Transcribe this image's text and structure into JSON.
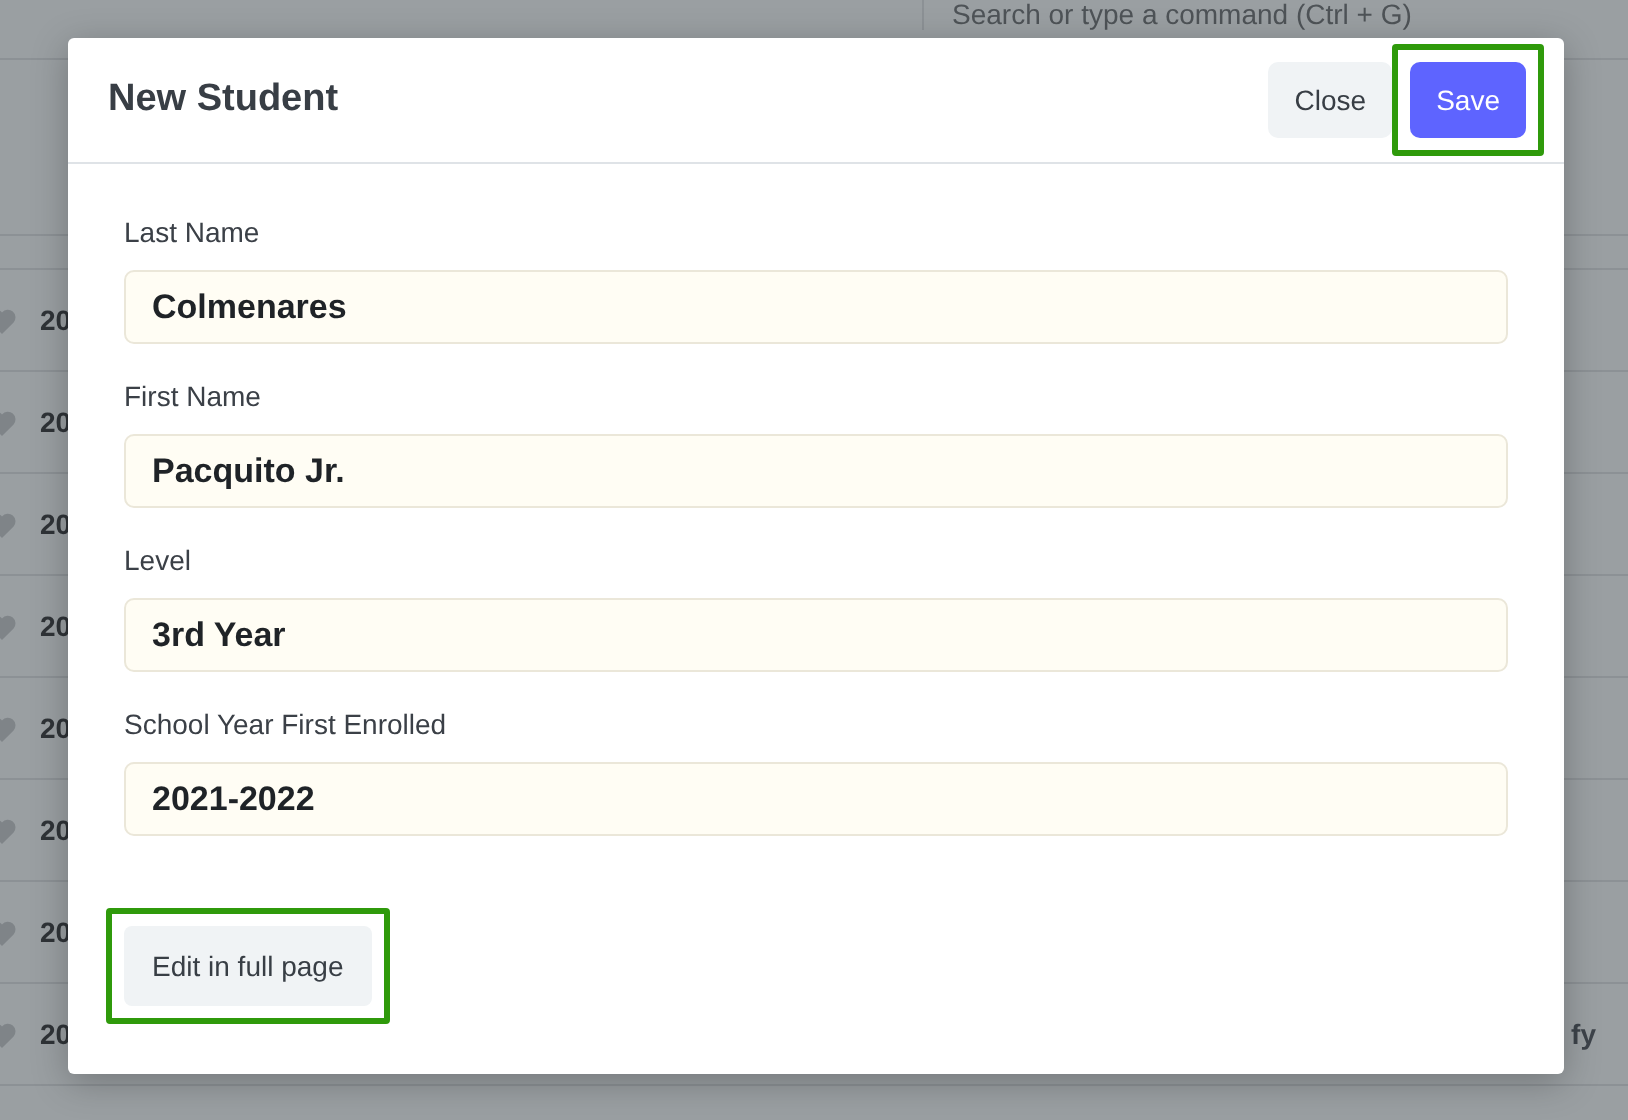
{
  "background": {
    "search": {
      "placeholder": "Search or type a command (Ctrl + G)"
    },
    "rows": [
      {
        "column_1": "20"
      },
      {
        "column_1": "20"
      },
      {
        "column_1": "20"
      },
      {
        "column_1": "20"
      },
      {
        "column_1": "20"
      },
      {
        "column_1": "20"
      },
      {
        "column_1": "20"
      },
      {
        "column_1": "20",
        "column_3": "fy"
      }
    ]
  },
  "modal": {
    "title": "New Student",
    "buttons": [
      {
        "label": "Close",
        "kind": "secondary",
        "highlighted": false
      },
      {
        "label": "Save",
        "kind": "primary",
        "highlighted": true
      }
    ],
    "fields": [
      {
        "label": "Last Name",
        "value": "Colmenares"
      },
      {
        "label": "First Name",
        "value": "Pacquito Jr."
      },
      {
        "label": "Level",
        "value": "3rd Year"
      },
      {
        "label": "School Year First Enrolled",
        "value": "2021-2022"
      }
    ],
    "footer_button": {
      "label": "Edit in full page",
      "highlighted": true
    }
  }
}
